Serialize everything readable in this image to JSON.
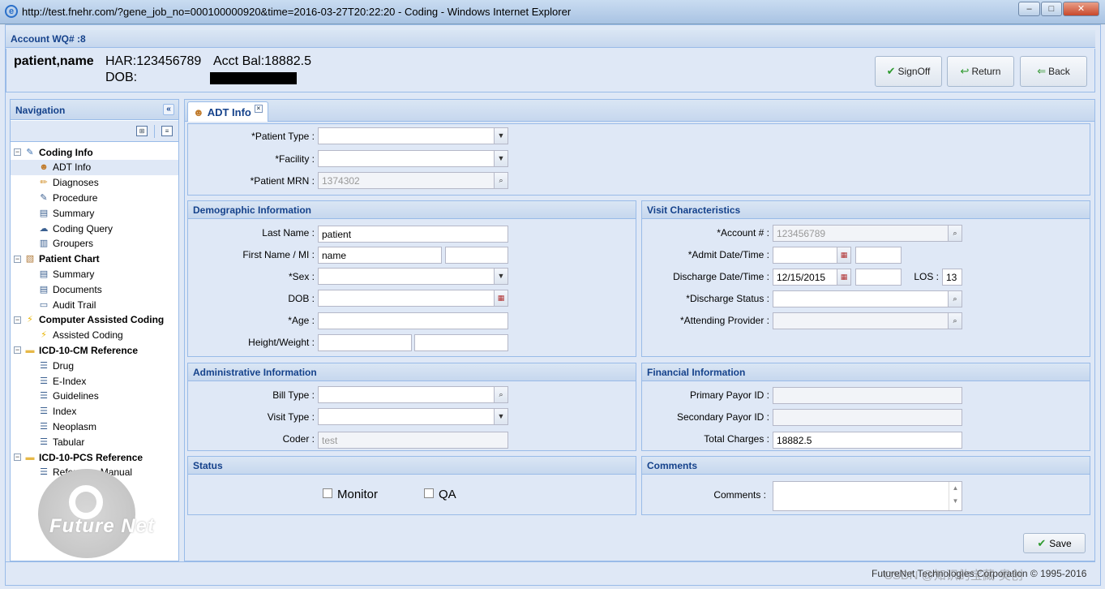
{
  "window": {
    "title": "http://test.fnehr.com/?gene_job_no=000100000920&time=2016-03-27T20:22:20 - Coding - Windows Internet Explorer",
    "minimize": "–",
    "maximize": "□",
    "close": "✕"
  },
  "header": {
    "panel_title": "Account WQ# :8",
    "patient_name": "patient,name",
    "har": "HAR:123456789",
    "acct_bal": "Acct Bal:18882.5",
    "dob": "DOB:",
    "buttons": {
      "signoff": "SignOff",
      "return": "Return",
      "back": "Back"
    }
  },
  "navigation": {
    "title": "Navigation",
    "tree": [
      {
        "label": "Coding Info",
        "top": true,
        "icon": "edit-icon"
      },
      {
        "label": "ADT Info",
        "icon": "person-icon",
        "selected": true
      },
      {
        "label": "Diagnoses",
        "icon": "pencil-icon"
      },
      {
        "label": "Procedure",
        "icon": "syringe-icon"
      },
      {
        "label": "Summary",
        "icon": "summary-icon"
      },
      {
        "label": "Coding Query",
        "icon": "query-icon"
      },
      {
        "label": "Groupers",
        "icon": "groupers-icon"
      },
      {
        "label": "Patient Chart",
        "top": true,
        "icon": "clipboard-icon"
      },
      {
        "label": "Summary",
        "icon": "summary-icon"
      },
      {
        "label": "Documents",
        "icon": "documents-icon"
      },
      {
        "label": "Audit Trail",
        "icon": "audit-icon"
      },
      {
        "label": "Computer Assisted Coding",
        "top": true,
        "icon": "lightning-icon"
      },
      {
        "label": "Assisted Coding",
        "icon": "lightning-icon"
      },
      {
        "label": "ICD-10-CM Reference",
        "top": true,
        "icon": "folder-icon"
      },
      {
        "label": "Drug",
        "icon": "list-icon"
      },
      {
        "label": "E-Index",
        "icon": "list-icon"
      },
      {
        "label": "Guidelines",
        "icon": "list-icon"
      },
      {
        "label": "Index",
        "icon": "list-icon"
      },
      {
        "label": "Neoplasm",
        "icon": "list-icon"
      },
      {
        "label": "Tabular",
        "icon": "list-icon"
      },
      {
        "label": "ICD-10-PCS Reference",
        "top": true,
        "icon": "folder-icon"
      },
      {
        "label": "Reference Manual",
        "icon": "list-icon"
      }
    ],
    "logo_text": "Future Net"
  },
  "tab": {
    "label": "ADT Info"
  },
  "top_fields": {
    "patient_type": {
      "label": "*Patient Type :",
      "value": ""
    },
    "facility": {
      "label": "*Facility :",
      "value": ""
    },
    "patient_mrn": {
      "label": "*Patient MRN :",
      "value": "1374302"
    }
  },
  "demographic": {
    "title": "Demographic Information",
    "last_name": {
      "label": "Last Name :",
      "value": "patient"
    },
    "first_name": {
      "label": "First Name / MI :",
      "value": "name",
      "mi": ""
    },
    "sex": {
      "label": "*Sex :",
      "value": ""
    },
    "dob": {
      "label": "DOB :",
      "value": ""
    },
    "age": {
      "label": "*Age :",
      "value": ""
    },
    "height_weight": {
      "label": "Height/Weight :",
      "height": "",
      "weight": ""
    }
  },
  "visit": {
    "title": "Visit Characteristics",
    "account": {
      "label": "*Account # :",
      "value": "123456789"
    },
    "admit": {
      "label": "*Admit Date/Time :",
      "date": "",
      "time": ""
    },
    "discharge": {
      "label": "Discharge Date/Time :",
      "date": "12/15/2015",
      "time": ""
    },
    "los": {
      "label": "LOS :",
      "value": "13"
    },
    "discharge_status": {
      "label": "*Discharge Status :",
      "value": ""
    },
    "attending": {
      "label": "*Attending Provider :",
      "value": ""
    }
  },
  "administrative": {
    "title": "Administrative Information",
    "bill_type": {
      "label": "Bill Type :",
      "value": ""
    },
    "visit_type": {
      "label": "Visit Type :",
      "value": ""
    },
    "coder": {
      "label": "Coder :",
      "value": "test"
    }
  },
  "financial": {
    "title": "Financial Information",
    "primary": {
      "label": "Primary Payor ID :",
      "value": ""
    },
    "secondary": {
      "label": "Secondary Payor ID :",
      "value": ""
    },
    "total": {
      "label": "Total Charges :",
      "value": "18882.5"
    }
  },
  "status": {
    "title": "Status",
    "monitor": "Monitor",
    "qa": "QA"
  },
  "comments": {
    "title": "Comments",
    "label": "Comments :",
    "value": ""
  },
  "save_label": "Save",
  "footer": "FutureNet Technologies Corporation © 1995-2016",
  "watermark": "CSDN @知识的宝藏·奥创"
}
